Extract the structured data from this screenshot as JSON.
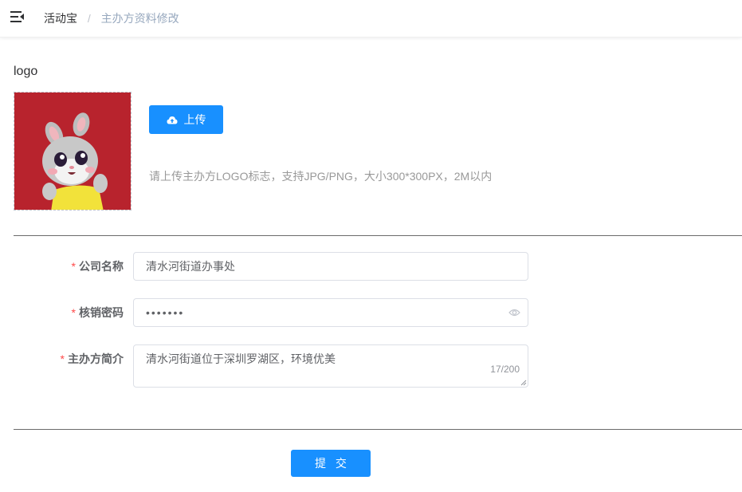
{
  "breadcrumb": {
    "home": "活动宝",
    "separator": "/",
    "current": "主办方资料修改"
  },
  "logo_section": {
    "title": "logo",
    "upload_label": "上传",
    "tip": "请上传主办方LOGO标志，支持JPG/PNG，大小300*300PX，2M以内",
    "image_icon": "bunny-cartoon-image",
    "image_bg_color": "#b8232d"
  },
  "form": {
    "required_mark": "*",
    "company": {
      "label": "公司名称",
      "value": "清水河街道办事处"
    },
    "password": {
      "label": "核销密码",
      "value": "•••••••"
    },
    "intro": {
      "label": "主办方简介",
      "value": "清水河街道位于深圳罗湖区，环境优美",
      "count": "17/200"
    },
    "submit_label": "提 交"
  },
  "colors": {
    "primary": "#1890ff",
    "required": "#ff4949"
  },
  "icons": [
    "menu-fold-icon",
    "cloud-upload-icon",
    "eye-icon"
  ]
}
